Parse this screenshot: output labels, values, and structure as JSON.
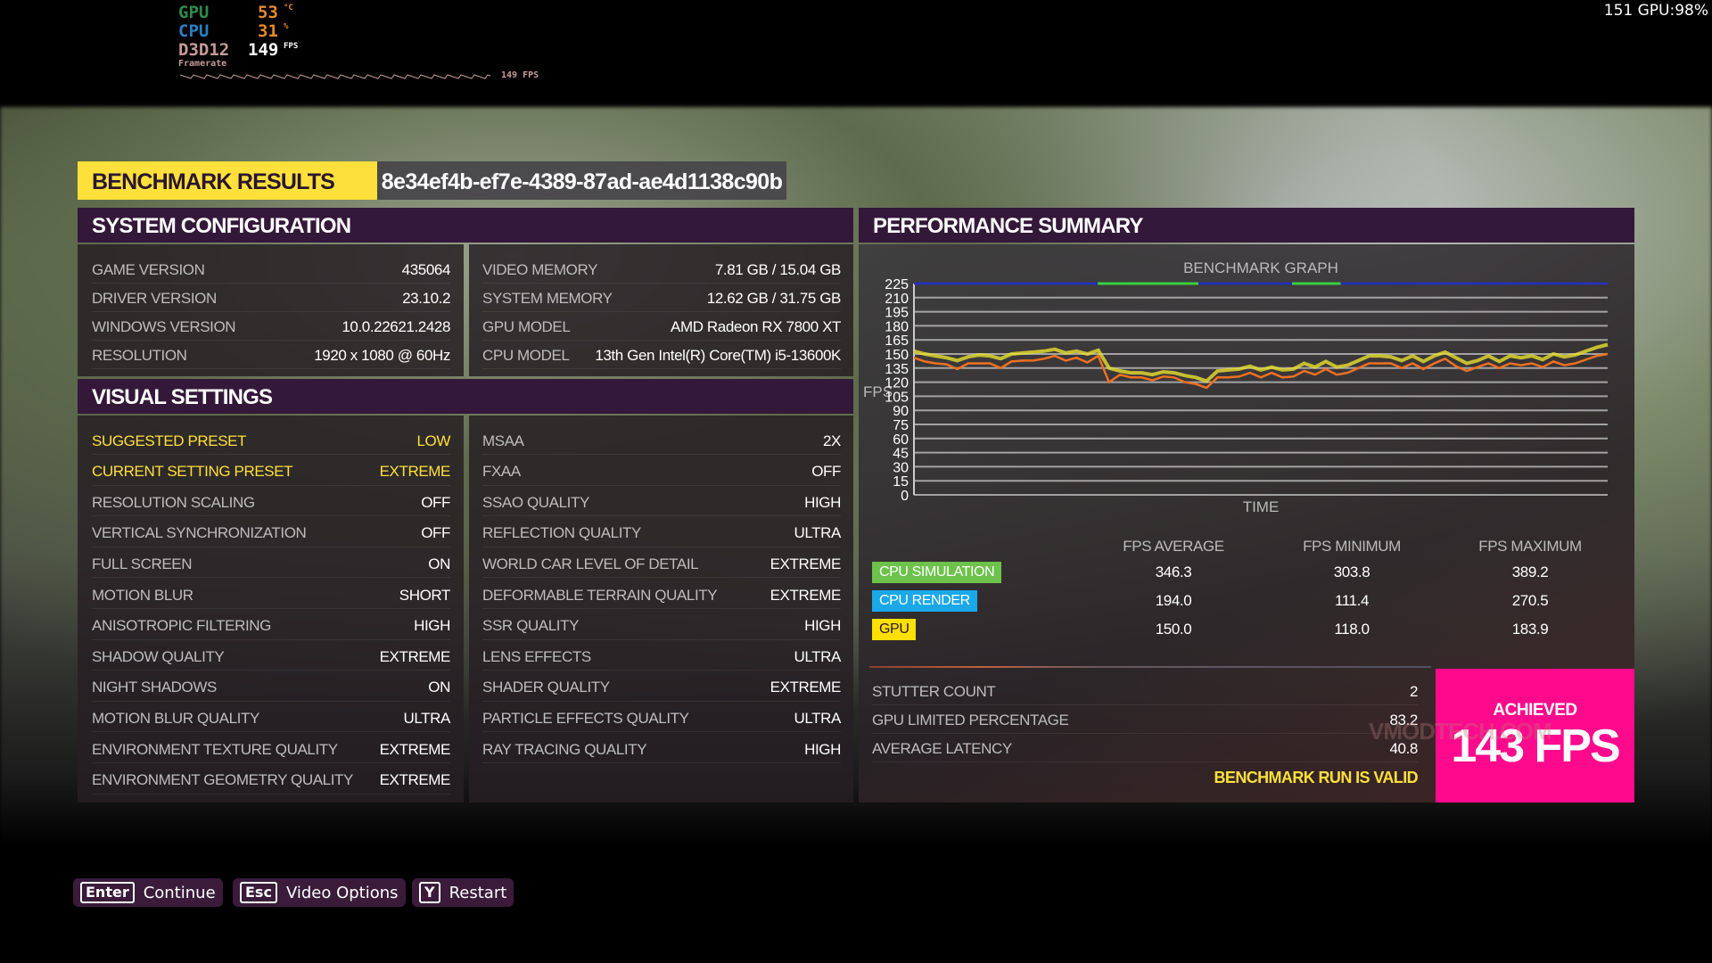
{
  "overlay": {
    "gpu_label": "GPU",
    "gpu_value": "53",
    "gpu_unit": "°C",
    "cpu_label": "CPU",
    "cpu_value": "31",
    "cpu_unit": "%",
    "api_label": "D3D12",
    "fps_value": "149",
    "fps_unit": "FPS",
    "framerate_label": "Framerate",
    "graph_fps": "149 FPS",
    "corner": "151 GPU:98%"
  },
  "header": {
    "title": "BENCHMARK RESULTS",
    "guid": "8e34ef4b-ef7e-4389-87ad-ae4d1138c90b"
  },
  "system_config": {
    "title": "SYSTEM CONFIGURATION",
    "left": [
      {
        "k": "GAME VERSION",
        "v": "435064"
      },
      {
        "k": "DRIVER VERSION",
        "v": "23.10.2"
      },
      {
        "k": "WINDOWS VERSION",
        "v": "10.0.22621.2428"
      },
      {
        "k": "RESOLUTION",
        "v": "1920 x 1080 @ 60Hz"
      }
    ],
    "right": [
      {
        "k": "VIDEO MEMORY",
        "v": "7.81 GB / 15.04 GB"
      },
      {
        "k": "SYSTEM MEMORY",
        "v": "12.62 GB / 31.75 GB"
      },
      {
        "k": "GPU MODEL",
        "v": "AMD Radeon RX 7800 XT"
      },
      {
        "k": "CPU MODEL",
        "v": "13th Gen Intel(R) Core(TM) i5-13600K"
      }
    ]
  },
  "visual_settings": {
    "title": "VISUAL SETTINGS",
    "left": [
      {
        "k": "SUGGESTED PRESET",
        "v": "LOW"
      },
      {
        "k": "CURRENT SETTING PRESET",
        "v": "EXTREME"
      },
      {
        "k": "RESOLUTION SCALING",
        "v": "OFF"
      },
      {
        "k": "VERTICAL SYNCHRONIZATION",
        "v": "OFF"
      },
      {
        "k": "FULL SCREEN",
        "v": "ON"
      },
      {
        "k": "MOTION BLUR",
        "v": "SHORT"
      },
      {
        "k": "ANISOTROPIC FILTERING",
        "v": "HIGH"
      },
      {
        "k": "SHADOW QUALITY",
        "v": "EXTREME"
      },
      {
        "k": "NIGHT SHADOWS",
        "v": "ON"
      },
      {
        "k": "MOTION BLUR QUALITY",
        "v": "ULTRA"
      },
      {
        "k": "ENVIRONMENT TEXTURE QUALITY",
        "v": "EXTREME"
      },
      {
        "k": "ENVIRONMENT GEOMETRY QUALITY",
        "v": "EXTREME"
      }
    ],
    "right": [
      {
        "k": "MSAA",
        "v": "2X"
      },
      {
        "k": "FXAA",
        "v": "OFF"
      },
      {
        "k": "SSAO QUALITY",
        "v": "HIGH"
      },
      {
        "k": "REFLECTION QUALITY",
        "v": "ULTRA"
      },
      {
        "k": "WORLD CAR LEVEL OF DETAIL",
        "v": "EXTREME"
      },
      {
        "k": "DEFORMABLE TERRAIN QUALITY",
        "v": "EXTREME"
      },
      {
        "k": "SSR QUALITY",
        "v": "HIGH"
      },
      {
        "k": "LENS EFFECTS",
        "v": "ULTRA"
      },
      {
        "k": "SHADER QUALITY",
        "v": "EXTREME"
      },
      {
        "k": "PARTICLE EFFECTS QUALITY",
        "v": "ULTRA"
      },
      {
        "k": "RAY TRACING QUALITY",
        "v": "HIGH"
      }
    ]
  },
  "performance": {
    "title": "PERFORMANCE SUMMARY",
    "columns": [
      "FPS AVERAGE",
      "FPS MINIMUM",
      "FPS MAXIMUM"
    ],
    "rows": [
      {
        "label": "CPU SIMULATION",
        "color": "#6cc24a",
        "text_color": "#ffffff",
        "avg": "346.3",
        "min": "303.8",
        "max": "389.2"
      },
      {
        "label": "CPU RENDER",
        "color": "#1aa8e8",
        "text_color": "#ffffff",
        "avg": "194.0",
        "min": "111.4",
        "max": "270.5"
      },
      {
        "label": "GPU",
        "color": "#fde000",
        "text_color": "#2b1530",
        "avg": "150.0",
        "min": "118.0",
        "max": "183.9"
      }
    ],
    "stats": [
      {
        "k": "STUTTER COUNT",
        "v": "2"
      },
      {
        "k": "GPU LIMITED PERCENTAGE",
        "v": "83.2"
      },
      {
        "k": "AVERAGE LATENCY",
        "v": "40.8"
      }
    ],
    "valid": "BENCHMARK RUN IS VALID",
    "achieved_label": "ACHIEVED",
    "achieved_value": "143 FPS",
    "achieved_color": "#ff0a8c",
    "watermark": "VMODTECH.COM"
  },
  "chart_data": {
    "type": "line",
    "title": "BENCHMARK GRAPH",
    "xlabel": "TIME",
    "ylabel": "FPS",
    "ylim": [
      0,
      225
    ],
    "yticks": [
      0,
      15,
      30,
      45,
      60,
      75,
      90,
      105,
      120,
      135,
      150,
      165,
      180,
      195,
      210,
      225
    ],
    "grid": true,
    "series": [
      {
        "color": "#f07020",
        "values": [
          146,
          142,
          140,
          139,
          134,
          140,
          140,
          140,
          135,
          142,
          143,
          143,
          145,
          148,
          143,
          146,
          141,
          148,
          120,
          128,
          125,
          125,
          122,
          126,
          125,
          120,
          118,
          114,
          125,
          125,
          126,
          130,
          125,
          130,
          125,
          126,
          132,
          128,
          134,
          128,
          130,
          135,
          140,
          140,
          140,
          135,
          140,
          134,
          140,
          145,
          137,
          132,
          136,
          140,
          135,
          140,
          138,
          140,
          136,
          142,
          138,
          140,
          144,
          148,
          150
        ]
      },
      {
        "color": "#e8e030",
        "values": [
          153,
          150,
          148,
          146,
          143,
          147,
          149,
          148,
          145,
          150,
          151,
          152,
          153,
          155,
          151,
          153,
          150,
          154,
          135,
          132,
          130,
          130,
          128,
          131,
          130,
          127,
          125,
          121,
          132,
          133,
          134,
          137,
          133,
          136,
          133,
          134,
          140,
          136,
          142,
          136,
          138,
          143,
          148,
          148,
          147,
          143,
          148,
          142,
          148,
          152,
          146,
          140,
          143,
          148,
          142,
          148,
          146,
          148,
          144,
          150,
          147,
          149,
          153,
          157,
          160
        ]
      },
      {
        "color": "#2030c0",
        "values": [
          225,
          225,
          225,
          225,
          225,
          225,
          225,
          225,
          225,
          225,
          225,
          225,
          225,
          225,
          225,
          225,
          225,
          225,
          225,
          225,
          225,
          225,
          225,
          225,
          225,
          225,
          225,
          225,
          225,
          225,
          225,
          225,
          225,
          225,
          225,
          225,
          225,
          225,
          225,
          225,
          225,
          225,
          225,
          225,
          225,
          225,
          225,
          225,
          225,
          225,
          225,
          225,
          225,
          225,
          225,
          225,
          225,
          225,
          225,
          225,
          225,
          225,
          225,
          225,
          225
        ]
      }
    ],
    "cpu_bound_segments": [
      [
        0.265,
        0.41
      ],
      [
        0.545,
        0.615
      ]
    ],
    "cpu_bound_color": "#3ad040"
  },
  "buttons": [
    {
      "key": "Enter",
      "label": "Continue"
    },
    {
      "key": "Esc",
      "label": "Video Options"
    },
    {
      "key": "Y",
      "label": "Restart"
    }
  ]
}
